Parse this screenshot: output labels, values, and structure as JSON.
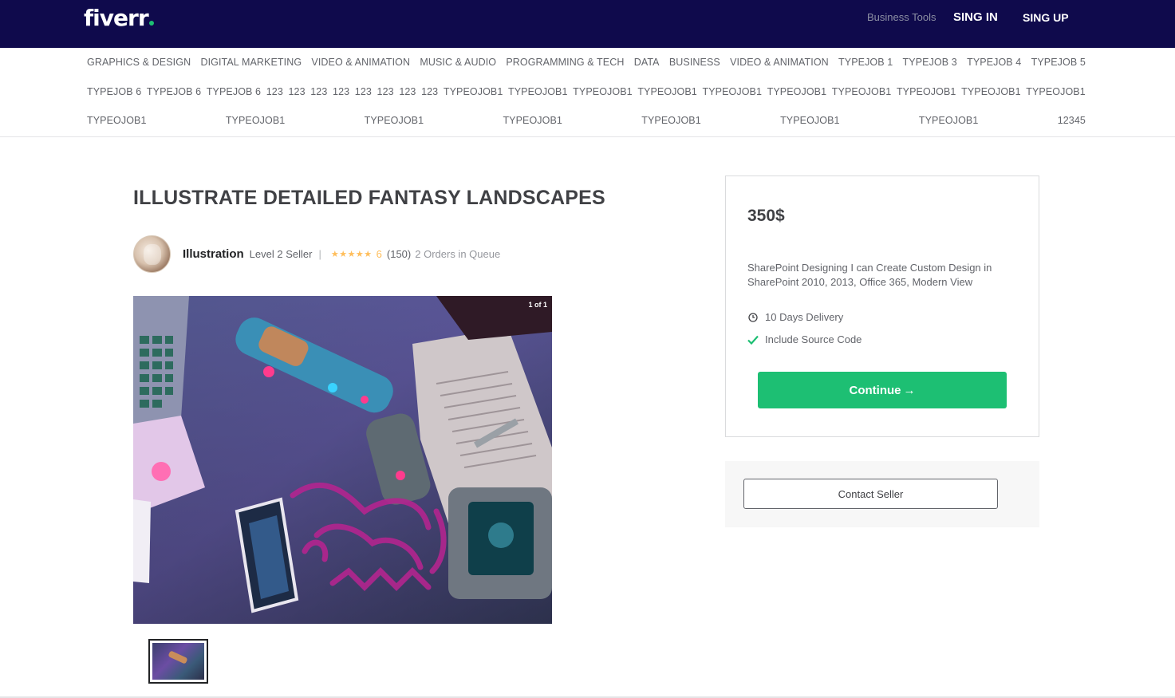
{
  "header": {
    "logo": "fiverr",
    "business_tools": "Business Tools",
    "sign_in": "SING IN",
    "sign_up": "SING UP",
    "background_color": "#0f0a4c"
  },
  "categories": {
    "row1": [
      "GRAPHICS & DESIGN",
      "DIGITAL MARKETING",
      "VIDEO & ANIMATION",
      "MUSIC & AUDIO",
      "PROGRAMMING & TECH",
      "DATA",
      "BUSINESS",
      "VIDEO & ANIMATION",
      "TYPEJOB 1",
      "TYPEJOB 3",
      "TYPEJOB 4",
      "TYPEJOB 5"
    ],
    "row2": [
      "TYPEJOB 6",
      "TYPEJOB 6",
      "TYPEJOB 6",
      "123",
      "123",
      "123",
      "123",
      "123",
      "123",
      "123",
      "123",
      "TYPEOJOB1",
      "TYPEOJOB1",
      "TYPEOJOB1",
      "TYPEOJOB1",
      "TYPEOJOB1",
      "TYPEOJOB1",
      "TYPEOJOB1",
      "TYPEOJOB1",
      "TYPEOJOB1",
      "TYPEOJOB1"
    ],
    "row3": [
      "TYPEOJOB1",
      "TYPEOJOB1",
      "TYPEOJOB1",
      "TYPEOJOB1",
      "TYPEOJOB1",
      "TYPEOJOB1",
      "TYPEOJOB1",
      "12345"
    ]
  },
  "gig": {
    "title": "ILLUSTRATE DETAILED FANTASY LANDSCAPES",
    "seller_name": "Illustration",
    "seller_level": "Level 2 Seller",
    "divider": "|",
    "stars": "★★★★★",
    "rating": "6",
    "reviews": "(150)",
    "queue": "2 Orders in Queue",
    "gallery_counter": "1 of 1"
  },
  "package": {
    "price": "350$",
    "description": "SharePoint Designing I can Create Custom Design in SharePoint 2010, 2013, Office 365, Modern View",
    "delivery": "10 Days Delivery",
    "source_code": "Include Source Code",
    "continue_label": "Continue",
    "continue_arrow": "→",
    "accent_color": "#1dbf73"
  },
  "contact": {
    "label": "Contact Seller"
  }
}
